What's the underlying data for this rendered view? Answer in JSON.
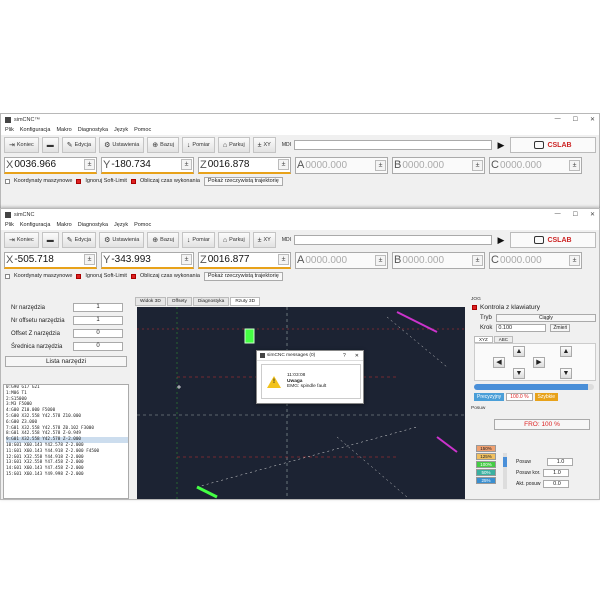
{
  "app": {
    "title": "simCNC™",
    "title2": "simCNC"
  },
  "window_controls": {
    "minimize": "—",
    "maximize": "☐",
    "close": "✕"
  },
  "menu": [
    "Plik",
    "Konfiguracja",
    "Makro",
    "Diagnostyka",
    "Język",
    "Pomoc"
  ],
  "toolbar": {
    "buttons": [
      "Koniec",
      "",
      "Edycja",
      "Ustawienia",
      "Bazuj",
      "Pomiar",
      "Parkuj",
      "XY"
    ],
    "mdi_label": "MDI",
    "play": "▶",
    "logo": "CSLAB"
  },
  "win1_axes": [
    {
      "label": "X",
      "value": "0036.966",
      "active": true
    },
    {
      "label": "Y",
      "value": "-180.734",
      "active": true
    },
    {
      "label": "Z",
      "value": "0016.878",
      "active": true
    },
    {
      "label": "A",
      "value": "0000.000",
      "active": false
    },
    {
      "label": "B",
      "value": "0000.000",
      "active": false
    },
    {
      "label": "C",
      "value": "0000.000",
      "active": false
    }
  ],
  "win2_axes": [
    {
      "label": "X",
      "value": "-505.718",
      "active": true
    },
    {
      "label": "Y",
      "value": "-343.993",
      "active": true
    },
    {
      "label": "Z",
      "value": "0016.877",
      "active": true
    },
    {
      "label": "A",
      "value": "0000.000",
      "active": false
    },
    {
      "label": "B",
      "value": "0000.000",
      "active": false
    },
    {
      "label": "C",
      "value": "0000.000",
      "active": false
    }
  ],
  "options": {
    "machine_coords": "Koordynaty maszynowe",
    "ignore_softlimit": "Ignoruj Soft-Limit",
    "calc_time": "Obliczaj czas wykonania",
    "show_traj": "Pokaż rzeczywistą trajektorię",
    "jog_label": "JOG"
  },
  "tool_form": {
    "rows": [
      {
        "label": "Nr narzędzia",
        "value": "1"
      },
      {
        "label": "Nr offsetu narzędzia",
        "value": "1"
      },
      {
        "label": "Offset Z narzędzia",
        "value": "0"
      },
      {
        "label": "Średnica narzędzia",
        "value": "0"
      }
    ],
    "list_button": "Lista narzędzi"
  },
  "gcode": [
    "0:G90 G17 G21",
    "1:M06 T1",
    "2:S15000",
    "3:M3 F5000",
    "4:G00 Z10.000 F5000",
    "5:G00 X32.558 Y42.578 Z10.000",
    "6:G00 Z3.000",
    "7:G01 X32.558 Y42.578 Z0.102 F3000",
    "8:G01 X42.558 Y42.578 Z-0.949",
    "9:G01 X32.558 Y42.578 Z-2.000",
    "10:G01 X60.143 Y42.578 Z-2.000",
    "11:G01 X60.143 Y44.918 Z-2.000 F4500",
    "12:G01 X32.558 Y44.918 Z-2.000",
    "13:G01 X32.558 Y47.458 Z-2.000",
    "14:G01 X60.143 Y47.458 Z-2.000",
    "15:G01 X60.143 Y49.998 Z-2.000"
  ],
  "view_tabs": [
    "Widok 3D",
    "Offsety",
    "Diagnostyka",
    "Rzuty 3D"
  ],
  "dialog": {
    "title": "simCNC messages (0)",
    "help": "?",
    "time": "11:03:08",
    "heading": "Uwaga",
    "text": "EMG: spindle fault"
  },
  "jog": {
    "keyboard": "Kontrola z klawiatury",
    "mode_label": "Tryb",
    "mode_value": "Ciągły",
    "step_label": "Krok",
    "step_value": "0.100",
    "change_btn": "Zmień",
    "tabs": [
      "XYZ",
      "ABC"
    ],
    "precise": "Precyzyjny",
    "percent": "100.0 %",
    "fast": "Szybkie",
    "feed_group": "Posuw",
    "fro": "FRO: 100 %",
    "fro_steps": [
      "150%",
      "125%",
      "100%",
      "50%",
      "25%"
    ],
    "feed_rows": [
      {
        "label": "Posuw",
        "value": "1.0"
      },
      {
        "label": "Posuw kor.",
        "value": "1.0"
      },
      {
        "label": "Akt. posuw",
        "value": "0.0"
      }
    ]
  },
  "colors": {
    "accent": "#e8a21a",
    "view_bg": "#1c2333",
    "red": "#dd2222",
    "jog_precise": "#4a9fd8",
    "jog_fast": "#e8a21a"
  }
}
